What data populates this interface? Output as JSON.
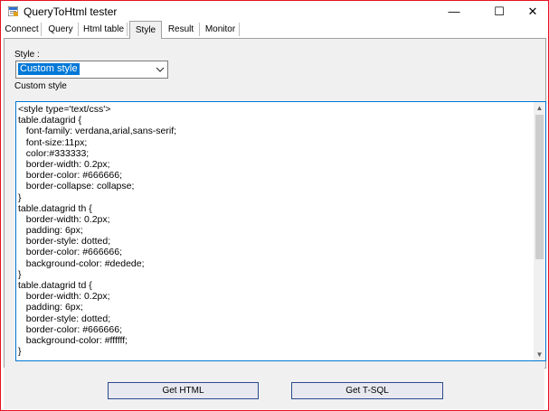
{
  "window": {
    "title": "QueryToHtml tester",
    "minimize_glyph": "—",
    "maximize_glyph": "☐",
    "close_glyph": "✕"
  },
  "tabs": [
    {
      "label": "Connect",
      "active": false
    },
    {
      "label": "Query",
      "active": false
    },
    {
      "label": "Html table",
      "active": false
    },
    {
      "label": "Style",
      "active": true
    },
    {
      "label": "Result",
      "active": false
    },
    {
      "label": "Monitor",
      "active": false
    }
  ],
  "style_page": {
    "style_label": "Style :",
    "style_selected": "Custom style",
    "custom_style_label": "Custom style",
    "css_lines": [
      "<style type='text/css'>",
      "table.datagrid {",
      "   font-family: verdana,arial,sans-serif;",
      "   font-size:11px;",
      "   color:#333333;",
      "   border-width: 0.2px;",
      "   border-color: #666666;",
      "   border-collapse: collapse;",
      "}",
      "table.datagrid th {",
      "   border-width: 0.2px;",
      "   padding: 6px;",
      "   border-style: dotted;",
      "   border-color: #666666;",
      "   background-color: #dedede;",
      "}",
      "table.datagrid td {",
      "   border-width: 0.2px;",
      "   padding: 6px;",
      "   border-style: dotted;",
      "   border-color: #666666;",
      "   background-color: #ffffff;",
      "}"
    ]
  },
  "buttons": {
    "get_html": "Get HTML",
    "get_tsql": "Get T-SQL"
  },
  "colors": {
    "accent": "#0078d7",
    "window_border": "#e81123",
    "panel": "#f0f0f0"
  }
}
